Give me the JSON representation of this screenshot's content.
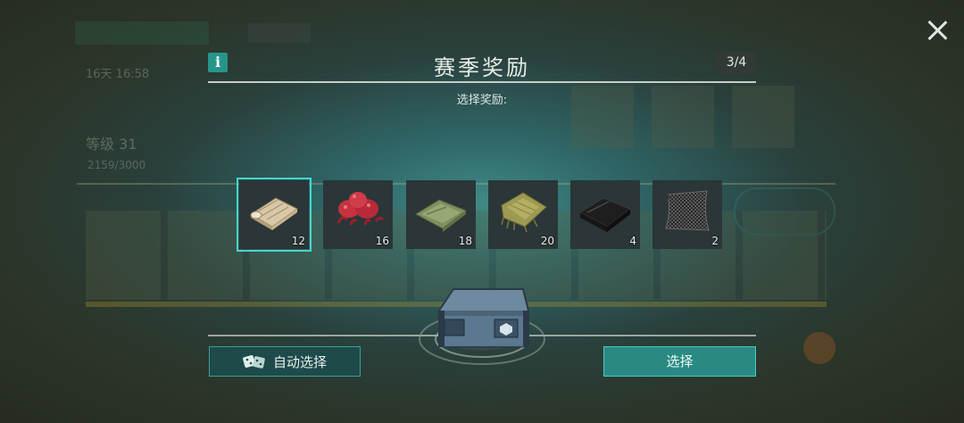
{
  "dialog": {
    "title": "赛季奖励",
    "page_indicator": "3/4",
    "subtitle": "选择奖励:",
    "info_icon_label": "i"
  },
  "items": [
    {
      "name": "cloth-roll",
      "icon": "cloth-roll-icon",
      "count": "12",
      "selected": true
    },
    {
      "name": "red-mushrooms",
      "icon": "red-mushroom-icon",
      "count": "16",
      "selected": false
    },
    {
      "name": "green-fabric",
      "icon": "green-fabric-icon",
      "count": "18",
      "selected": false
    },
    {
      "name": "burlap",
      "icon": "burlap-icon",
      "count": "20",
      "selected": false
    },
    {
      "name": "black-fabric",
      "icon": "black-fabric-icon",
      "count": "4",
      "selected": false
    },
    {
      "name": "kevlar-sheet",
      "icon": "kevlar-sheet-icon",
      "count": "2",
      "selected": false
    }
  ],
  "buttons": {
    "auto_select": "自动选择",
    "select": "选择"
  },
  "background": {
    "level_text": "等级 31",
    "xp_text": "2159/3000",
    "timer_text": "16天 16:58"
  },
  "colors": {
    "accent": "#45d6cd",
    "select_button": "#2a8a83",
    "auto_button": "#1f4a4a"
  }
}
